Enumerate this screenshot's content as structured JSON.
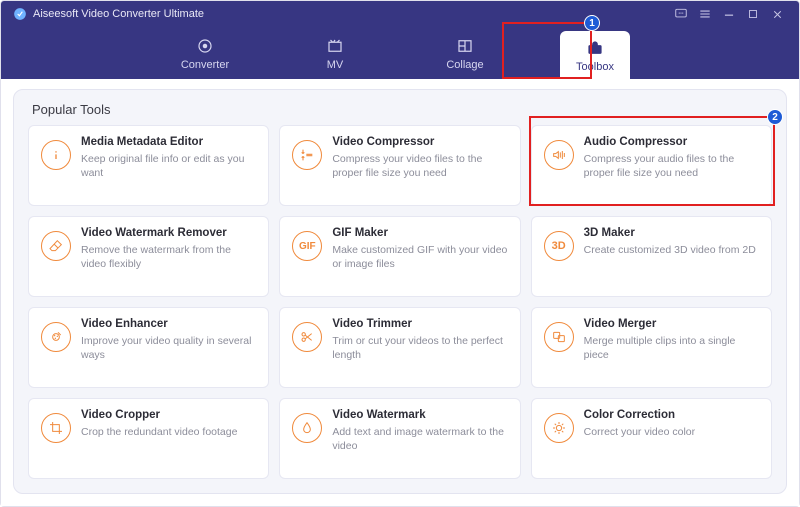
{
  "app_title": "Aiseesoft Video Converter Ultimate",
  "navtabs": [
    {
      "label": "Converter",
      "icon": "converter"
    },
    {
      "label": "MV",
      "icon": "mv"
    },
    {
      "label": "Collage",
      "icon": "collage"
    },
    {
      "label": "Toolbox",
      "icon": "toolbox"
    }
  ],
  "panel_title": "Popular Tools",
  "tools": [
    {
      "icon": "info",
      "title": "Media Metadata Editor",
      "desc": "Keep original file info or edit as you want"
    },
    {
      "icon": "compress",
      "title": "Video Compressor",
      "desc": "Compress your video files to the proper file size you need"
    },
    {
      "icon": "audio",
      "title": "Audio Compressor",
      "desc": "Compress your audio files to the proper file size you need"
    },
    {
      "icon": "erase",
      "title": "Video Watermark Remover",
      "desc": "Remove the watermark from the video flexibly"
    },
    {
      "icon": "gif",
      "title": "GIF Maker",
      "desc": "Make customized GIF with your video or image files"
    },
    {
      "icon": "3d",
      "title": "3D Maker",
      "desc": "Create customized 3D video from 2D"
    },
    {
      "icon": "enhance",
      "title": "Video Enhancer",
      "desc": "Improve your video quality in several ways"
    },
    {
      "icon": "trim",
      "title": "Video Trimmer",
      "desc": "Trim or cut your videos to the perfect length"
    },
    {
      "icon": "merge",
      "title": "Video Merger",
      "desc": "Merge multiple clips into a single piece"
    },
    {
      "icon": "crop",
      "title": "Video Cropper",
      "desc": "Crop the redundant video footage"
    },
    {
      "icon": "wm",
      "title": "Video Watermark",
      "desc": "Add text and image watermark to the video"
    },
    {
      "icon": "color",
      "title": "Color Correction",
      "desc": "Correct your video color"
    }
  ],
  "annotations": {
    "badge1": "1",
    "badge2": "2"
  }
}
